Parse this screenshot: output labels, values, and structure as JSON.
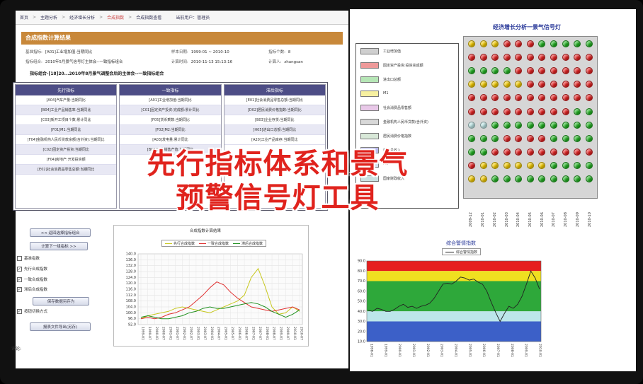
{
  "left": {
    "breadcrumb": [
      "首页",
      "主题分析",
      "经济增长分析",
      "合成指数",
      "合成指数查看"
    ],
    "user_label": "当前用户：管理员",
    "panel_title": "合成指数计算结果",
    "info": [
      {
        "label": "基准指标:",
        "value": "[A01]工业增加值:当期同比"
      },
      {
        "label": "样本日期:",
        "value": "1999-01 ~ 2010-10"
      },
      {
        "label": "指标个数:",
        "value": "8"
      },
      {
        "label": "指标组合:",
        "value": "2010年5月景气信号灯主体会--一致指标组合"
      },
      {
        "label": "计算时间:",
        "value": "2010-11-13 15:13:16"
      },
      {
        "label": "计算人:",
        "value": "zhangsan"
      }
    ],
    "selected_title": "指标组合-[18]20...2010年8月景气调整会后的主体会--一致指标组合",
    "columns": [
      {
        "header": "先行指标",
        "items": [
          "[A04]汽车产量:当期同比",
          "[B04]工业产品销售率:当期同比",
          "[C03]新开工项目个数:累计同比",
          "[F01]M1:当期同比",
          "[F04]金融机构人民币贷款余额(含外资):当期同比",
          "[C02]固定资产投资:当期同比",
          "[F04]房地产:开发投资额",
          "[E02]社会消费品零售总额:当期同比"
        ]
      },
      {
        "header": "一致指标",
        "items": [
          "[A01]工业增加值:当期同比",
          "[C01]固定资产投资:完成额:累计同比",
          "[F05]货币乘数:当期同比",
          "[F02]M2:当期同比",
          "[A03]发电量:累计同比",
          "[B01]工业销售产值:当期同比"
        ]
      },
      {
        "header": "滞后指标",
        "items": [
          "[E01]社会消费品零售总额:当期同比",
          "[D02]居民消费价格指数:当期同比",
          "[B03]企业存货:当期同比",
          "[H05]进出口总额:当期同比",
          "[A20]工业产品库存:当期同比"
        ]
      }
    ],
    "buttons": {
      "prev": "<< 返回选择指标组合",
      "next": "计算下一组指标 >>",
      "save": "保存数据另存为",
      "export": "报表文件导出(另存)"
    },
    "checkboxes": [
      {
        "label": "基准指数",
        "checked": false
      },
      {
        "label": "先行合成指数",
        "checked": true
      },
      {
        "label": "一致合成指数",
        "checked": true
      },
      {
        "label": "滞后合成指数",
        "checked": true
      },
      {
        "label": "按钮切换方式",
        "checked": true
      }
    ],
    "comment_label": "评论:"
  },
  "overlay_title": [
    "先行指标体系和景气",
    "预警信号灯工具"
  ],
  "signal": {
    "title": "经济增长分析一景气信号灯",
    "legend": [
      {
        "label": "工业增加值",
        "color": "#cfcfcf"
      },
      {
        "label": "固定资产投资:投资完成额",
        "color": "#ee9a9a"
      },
      {
        "label": "进出口总额",
        "color": "#b6e6b6"
      },
      {
        "label": "M1",
        "color": "#f6f0a0"
      },
      {
        "label": "社会消费品零售额",
        "color": "#e8c8e8"
      },
      {
        "label": "金融机构人民币贷款(含外资)",
        "color": "#d8d8d8"
      },
      {
        "label": "居民消费价格指数",
        "color": "#d8e8d8"
      },
      {
        "label": "税收总收入",
        "color": "#b8b8f0"
      },
      {
        "label": "M2",
        "color": "#d0e0f0"
      },
      {
        "label": "国家财政收入",
        "color": "#c8e0e0"
      }
    ],
    "dates": [
      "2009-12",
      "2010-01",
      "2010-02",
      "2010-03",
      "2010-04",
      "2010-05",
      "2010-06",
      "2010-07",
      "2010-08",
      "2010-09",
      "2010-10"
    ],
    "rows": [
      [
        "Y",
        "Y",
        "Y",
        "R",
        "R",
        "R",
        "G",
        "G",
        "G",
        "G",
        "G"
      ],
      [
        "R",
        "R",
        "R",
        "R",
        "R",
        "R",
        "R",
        "R",
        "R",
        "R",
        "R"
      ],
      [
        "G",
        "G",
        "G",
        "G",
        "R",
        "R",
        "R",
        "R",
        "R",
        "R",
        "R"
      ],
      [
        "Y",
        "Y",
        "Y",
        "Y",
        "Y",
        "R",
        "R",
        "R",
        "R",
        "R",
        "R"
      ],
      [
        "R",
        "R",
        "R",
        "R",
        "R",
        "R",
        "R",
        "R",
        "R",
        "R",
        "R"
      ],
      [
        "R",
        "R",
        "R",
        "R",
        "R",
        "R",
        "R",
        "R",
        "R",
        "G",
        "G"
      ],
      [
        "L",
        "L",
        "G",
        "G",
        "G",
        "G",
        "G",
        "G",
        "G",
        "G",
        "G"
      ],
      [
        "G",
        "G",
        "G",
        "R",
        "R",
        "R",
        "R",
        "G",
        "G",
        "G",
        "G"
      ],
      [
        "G",
        "G",
        "R",
        "R",
        "R",
        "R",
        "R",
        "R",
        "R",
        "R",
        "R"
      ],
      [
        "R",
        "Y",
        "Y",
        "Y",
        "Y",
        "Y",
        "Y",
        "G",
        "G",
        "G",
        "G"
      ],
      [
        "Y",
        "Y",
        "G",
        "G",
        "G",
        "G",
        "G",
        "G",
        "G",
        "G",
        "G"
      ]
    ],
    "lamp_colors": {
      "R": "#e22222",
      "Y": "#f0c800",
      "G": "#22b022",
      "L": "#b8e0e0"
    }
  },
  "chart_data": [
    {
      "type": "line",
      "title": "合成指数计算结果",
      "series": [
        {
          "name": "先行合成指数",
          "color": "#c8c820",
          "values": [
            96,
            98,
            99,
            100,
            101,
            103,
            104,
            103,
            102,
            101,
            100,
            102,
            104,
            106,
            108,
            112,
            124,
            130,
            118,
            104,
            99,
            100,
            104,
            101
          ]
        },
        {
          "name": "一致合成指数",
          "color": "#e03030",
          "values": [
            96,
            97,
            96,
            97,
            99,
            100,
            102,
            104,
            108,
            112,
            117,
            121,
            119,
            114,
            110,
            107,
            104,
            103,
            102,
            101,
            102,
            103,
            104,
            102
          ]
        },
        {
          "name": "滞后合成指数",
          "color": "#209020",
          "values": [
            97,
            98,
            97,
            96,
            96,
            97,
            98,
            100,
            101,
            103,
            104,
            103,
            103,
            104,
            105,
            106,
            107,
            106,
            104,
            101,
            99,
            97,
            99,
            102
          ]
        }
      ],
      "x": [
        "1999-01",
        "1999-07",
        "2000-01",
        "2000-07",
        "2001-01",
        "2001-07",
        "2002-01",
        "2002-07",
        "2003-01",
        "2003-07",
        "2004-01",
        "2004-07",
        "2005-01",
        "2005-07",
        "2006-01",
        "2006-07",
        "2007-01",
        "2007-07",
        "2008-01",
        "2008-07",
        "2009-01",
        "2009-07",
        "2010-01",
        "2010-07"
      ],
      "ylim": [
        92,
        140
      ],
      "yticks": [
        "140.0",
        "136.0",
        "132.0",
        "128.0",
        "124.0",
        "120.0",
        "116.0",
        "112.0",
        "108.0",
        "104.0",
        "100.0",
        "96.0",
        "92.0"
      ],
      "grid": true,
      "legend": "top"
    },
    {
      "type": "line",
      "title": "综合警情指数",
      "series": [
        {
          "name": "综合警情指数",
          "color": "#222222",
          "values": [
            41,
            40,
            43,
            42,
            40,
            40,
            42,
            45,
            47,
            44,
            45,
            43,
            45,
            46,
            48,
            53,
            60,
            67,
            68,
            67,
            70,
            74,
            73,
            71,
            72,
            69,
            67,
            60,
            49,
            39,
            30,
            38,
            45,
            43,
            47,
            55,
            67,
            80,
            73,
            62
          ]
        }
      ],
      "x": [
        "1998-01",
        "1999-01",
        "2000-01",
        "2001-01",
        "2002-01",
        "2003-01",
        "2004-01",
        "2005-01",
        "2006-01",
        "2007-01",
        "2008-01",
        "2009-01",
        "2010-01"
      ],
      "ylim": [
        10,
        90
      ],
      "yticks": [
        "90.0",
        "80.0",
        "70.0",
        "60.0",
        "50.0",
        "40.0",
        "30.0",
        "20.0",
        "10.0"
      ],
      "bands": [
        {
          "from": 80,
          "to": 90,
          "color": "#e61e1e"
        },
        {
          "from": 70,
          "to": 80,
          "color": "#f0e020"
        },
        {
          "from": 40,
          "to": 70,
          "color": "#2ea83a"
        },
        {
          "from": 30,
          "to": 40,
          "color": "#bce6ea"
        },
        {
          "from": 10,
          "to": 30,
          "color": "#3c60c8"
        }
      ],
      "legend": "top"
    }
  ]
}
